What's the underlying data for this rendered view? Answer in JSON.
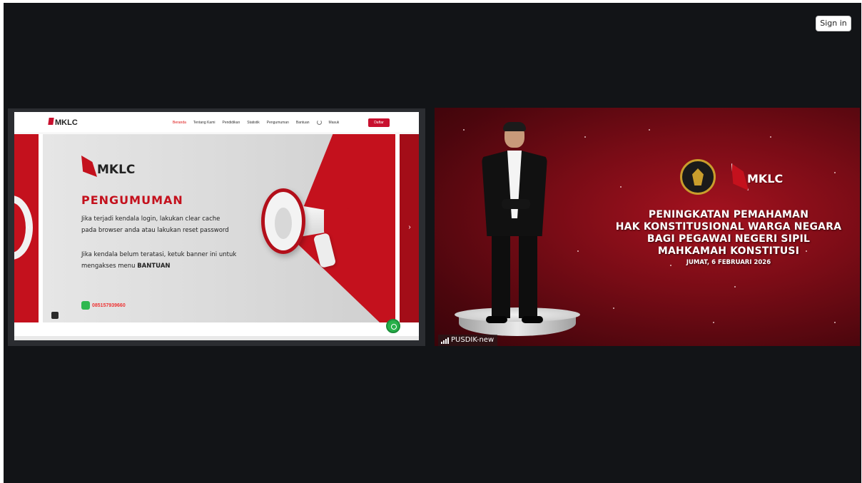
{
  "header": {
    "sign_in_label": "Sign in"
  },
  "screen_share": {
    "site": {
      "brand": "MKLC",
      "nav": [
        "Beranda",
        "Tentang Kami",
        "Pendidikan",
        "Statistik",
        "Pengumuman",
        "Bantuan",
        "Masuk"
      ],
      "daftar_label": "Daftar",
      "logo_text": "MKLC",
      "heading": "PENGUMUMAN",
      "message_line1": "Jika terjadi kendala login, lakukan clear cache",
      "message_line2": "pada browser anda atau lakukan reset password",
      "message_line3": "Jika kendala belum teratasi, ketuk banner ini untuk",
      "message_line4_prefix": "mengakses menu ",
      "message_line4_bold": "BANTUAN",
      "phone": "085157939660"
    }
  },
  "presenter_tile": {
    "logo_text": "MKLC",
    "title_lines": [
      "PENINGKATAN PEMAHAMAN",
      "HAK KONSTITUSIONAL WARGA NEGARA",
      "BAGI PEGAWAI NEGERI SIPIL",
      "MAHKAMAH KONSTITUSI"
    ],
    "date": "JUMAT, 6 FEBRUARI 2026",
    "participant_name": "PUSDIK-new"
  },
  "colors": {
    "accent_red": "#c4111d",
    "background": "#121417"
  }
}
